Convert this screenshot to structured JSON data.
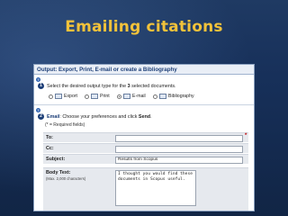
{
  "slide": {
    "title": "Emailing citations"
  },
  "panel": {
    "header": "Output: Export, Print, E-mail or create a Bibliography",
    "step1": {
      "number": "1",
      "pre": "Select the desired output type for the ",
      "count": "3",
      "post": " selected documents."
    },
    "options": [
      {
        "label": "Export",
        "selected": false,
        "icon": "export-icon"
      },
      {
        "label": "Print",
        "selected": false,
        "icon": "print-icon"
      },
      {
        "label": "E-mail",
        "selected": true,
        "icon": "email-icon"
      },
      {
        "label": "Bibliography",
        "selected": false,
        "icon": "bibliography-icon"
      }
    ],
    "step2": {
      "number": "2",
      "email": "Email",
      "text": ": Choose your preferences and click ",
      "send": "Send",
      "end": "."
    },
    "required_note": "(* = Required fields)",
    "fields": {
      "to_label": "To:",
      "to_value": "",
      "required_mark": "*",
      "cc_label": "Cc:",
      "cc_value": "",
      "subject_label": "Subject:",
      "subject_value": "Results from Scopus",
      "body_label": "Body Text:",
      "body_hint": "(Max. 2,000 characters)",
      "body_value": "I thought you would find these\ndocuments in Scopus useful."
    }
  }
}
